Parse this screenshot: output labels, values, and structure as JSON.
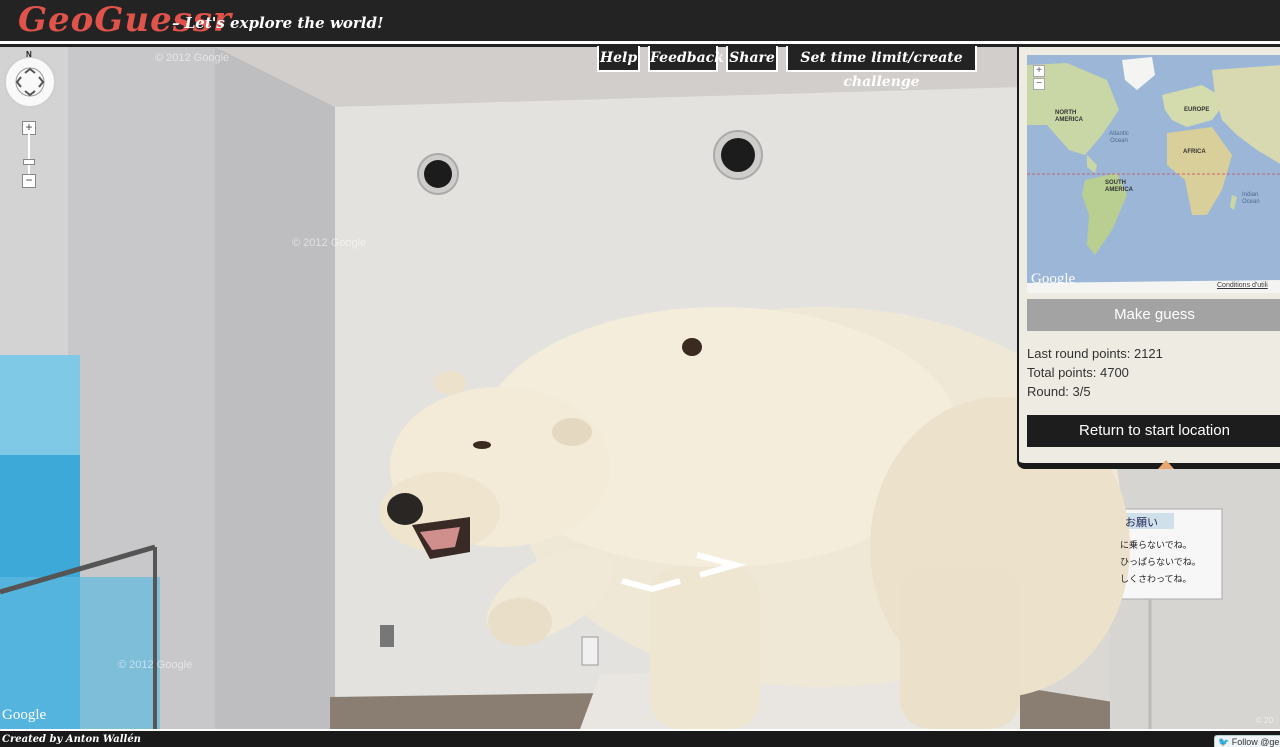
{
  "header": {
    "logo": "GeoGuessr",
    "tagline": "– Let's explore the world!"
  },
  "menu": {
    "help": "Help",
    "feedback": "Feedback",
    "share": "Share",
    "challenge": "Set time limit/create challenge"
  },
  "streetview": {
    "compass_north": "N",
    "zoom_in": "+",
    "zoom_out": "−",
    "watermark": "© 2012 Google",
    "google_logo": "Google",
    "copyright": "© 20",
    "sign_title": "お願い",
    "sign_lines": [
      "に乗らないでね。",
      "ひっぱらないでね。",
      "しくさわってね。"
    ]
  },
  "map": {
    "zoom_in": "+",
    "zoom_out": "−",
    "labels": {
      "north_america": "NORTH AMERICA",
      "europe": "EUROPE",
      "africa": "AFRICA",
      "south_america": "SOUTH AMERICA",
      "atlantic": "Atlantic Ocean",
      "indian": "Indian Ocean"
    },
    "google_logo": "Google",
    "terms": "Conditions d'utili",
    "make_guess": "Make guess"
  },
  "stats": {
    "last_round": "Last round points: 2121",
    "total": "Total points: 4700",
    "round": "Round: 3/5"
  },
  "return_button": "Return to start location",
  "footer": {
    "credit": "Created by Anton Wallén",
    "twitter": "Follow @ge"
  },
  "colors": {
    "logo": "#e0534b",
    "header_bg": "#232323",
    "panel_bg": "#eeebe3",
    "make_guess_bg": "#a3a3a3",
    "return_bg": "#1d1d1d"
  }
}
